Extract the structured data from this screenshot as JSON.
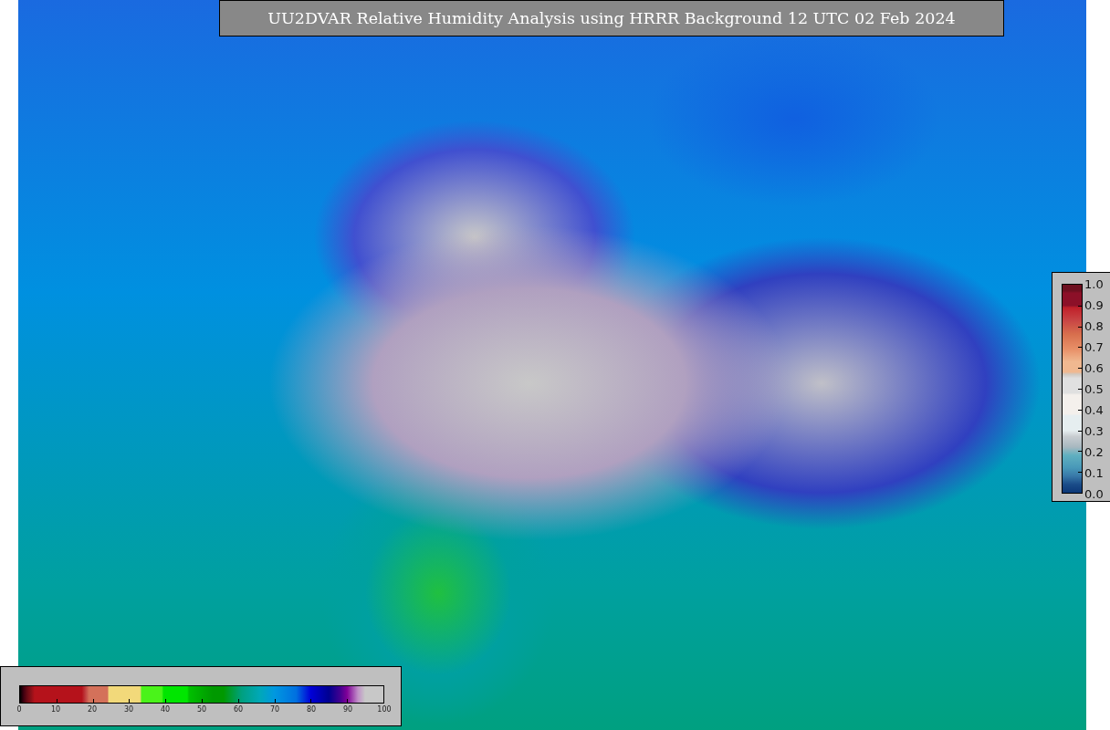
{
  "title": "UU2DVAR Relative Humidity Analysis using HRRR Background 12 UTC 02 Feb 2024",
  "colorbar_horizontal": {
    "ticks": [
      "0",
      "10",
      "20",
      "30",
      "40",
      "50",
      "60",
      "70",
      "80",
      "90",
      "100"
    ]
  },
  "colorbar_vertical": {
    "ticks": [
      "1.0",
      "0.9",
      "0.8",
      "0.7",
      "0.6",
      "0.5",
      "0.4",
      "0.3",
      "0.2",
      "0.1",
      "0.0"
    ]
  }
}
